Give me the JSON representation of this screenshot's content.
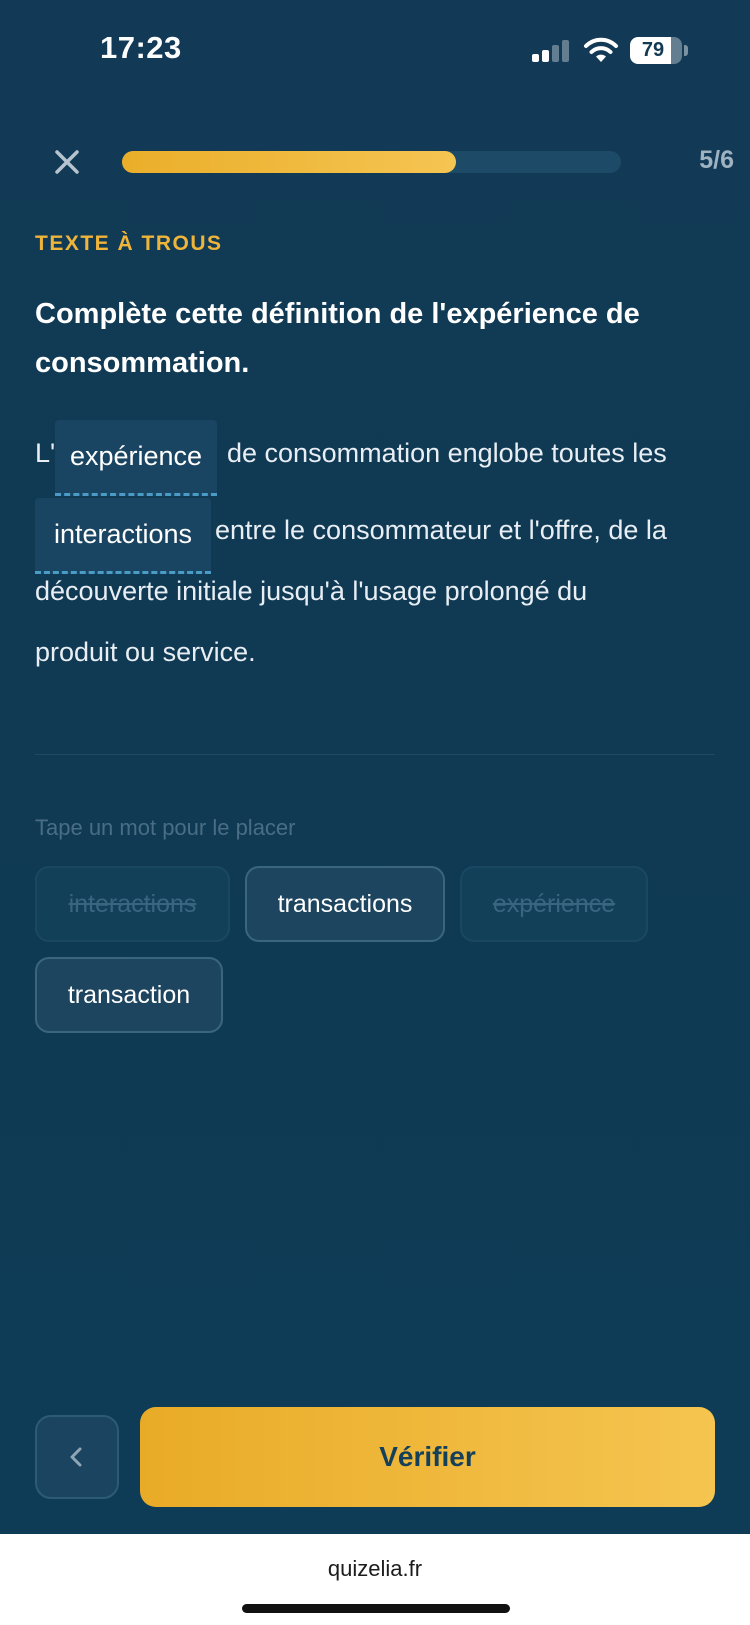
{
  "status_bar": {
    "time": "17:23",
    "battery": "79",
    "icons": [
      "signal-icon",
      "wifi-icon",
      "battery-icon"
    ]
  },
  "progress": {
    "count": "5/6",
    "fill_fraction": 0.67,
    "close_icon": "close-icon"
  },
  "quiz": {
    "kicker": "TEXTE À TROUS",
    "question": "Complète cette définition de l'expérience de consommation.",
    "passage": {
      "line1_prefix": "L'",
      "blank1": "expérience",
      "line1_suffix": "de consommation englobe toutes les",
      "blank2": "interactions",
      "line2_suffix": "entre le consommateur et l'offre, de la",
      "line3": "découverte initiale jusqu'à l'usage prolongé du",
      "line4": "produit ou service."
    },
    "hint": "Tape un mot pour le placer",
    "word_bank": [
      {
        "label": "interactions",
        "used": true
      },
      {
        "label": "transactions",
        "used": false
      },
      {
        "label": "expérience",
        "used": true
      },
      {
        "label": "transaction",
        "used": false
      }
    ]
  },
  "actions": {
    "back_icon": "chevron-left-icon",
    "verify_label": "Vérifier"
  },
  "browser": {
    "url": "quizelia.fr"
  },
  "colors": {
    "background": "#123a55",
    "accent": "#f0b43a",
    "blank_underline": "#4a9cc7"
  }
}
